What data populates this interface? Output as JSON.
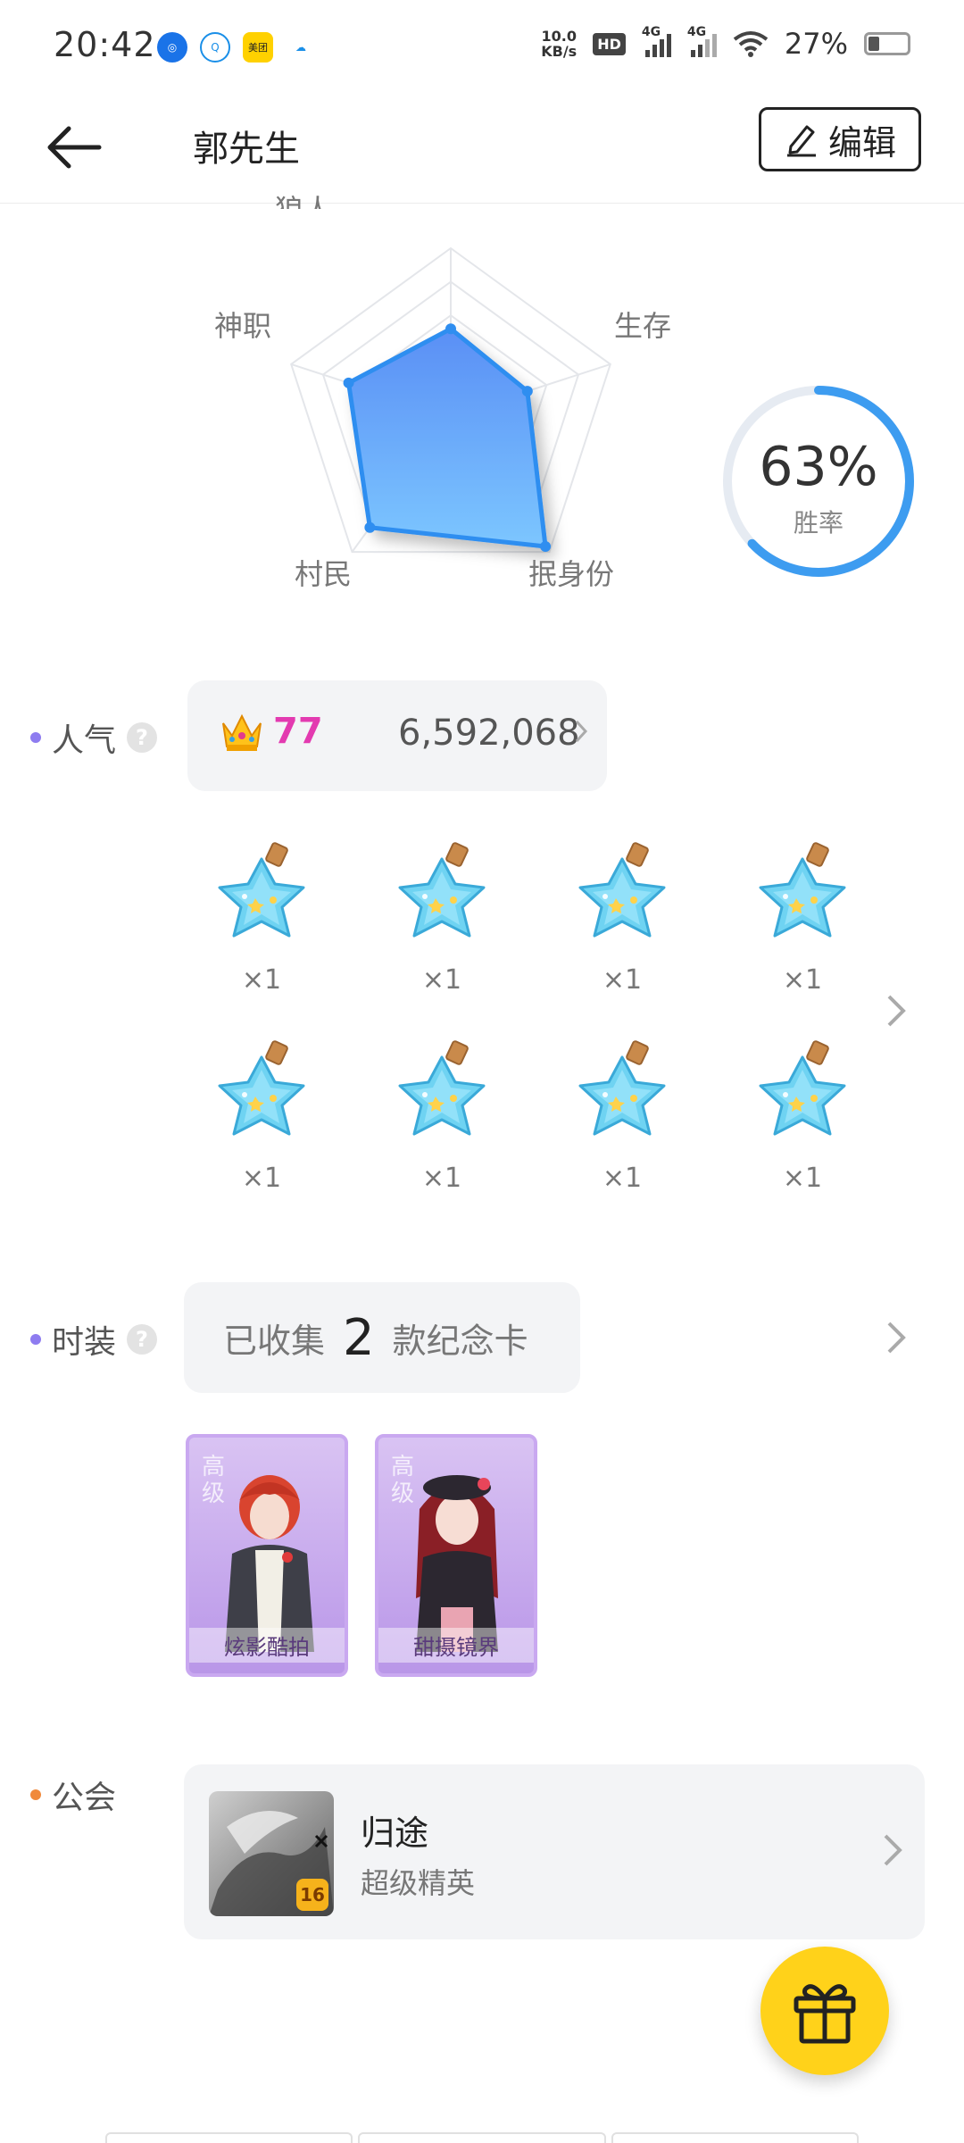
{
  "status_bar": {
    "time": "20:42",
    "net_speed_value": "10.0",
    "net_speed_unit": "KB/s",
    "hd_label": "HD",
    "signal_1": "4G",
    "signal_2": "4G",
    "battery": "27%",
    "app_icons": [
      "bank-app-icon",
      "q-app-icon",
      "meituan-app-icon",
      "cloud-app-icon"
    ],
    "meituan_label": "美团"
  },
  "header": {
    "title": "郭先生",
    "edit_label": "编辑"
  },
  "radar": {
    "axes": [
      "狼人",
      "生存",
      "抿身份",
      "村民",
      "神职"
    ],
    "top_label_visible": "狼人",
    "values": [
      0.52,
      0.48,
      0.96,
      0.82,
      0.64
    ],
    "fill_color": "#4a9bf5"
  },
  "winrate": {
    "value": "63%",
    "label": "胜率",
    "percent": 63,
    "ring_color": "#3d9cf0",
    "track_color": "#e6ebf2"
  },
  "popularity": {
    "label": "人气",
    "help": "?",
    "level": "77",
    "score": "6,592,068",
    "dot_color": "#8e7cf0",
    "level_color": "#e33ab0"
  },
  "gifts": {
    "items": [
      {
        "count": "×1"
      },
      {
        "count": "×1"
      },
      {
        "count": "×1"
      },
      {
        "count": "×1"
      },
      {
        "count": "×1"
      },
      {
        "count": "×1"
      },
      {
        "count": "×1"
      },
      {
        "count": "×1"
      }
    ]
  },
  "costume": {
    "label": "时装",
    "help": "?",
    "prefix": "已收集",
    "count": "2",
    "suffix": "款纪念卡",
    "dot_color": "#8e7cf0",
    "cards": [
      {
        "tier": "高级",
        "name": "炫影酷拍",
        "hair": "#d9442f"
      },
      {
        "tier": "高级",
        "name": "甜摄镜界",
        "hair": "#8a1f26"
      }
    ]
  },
  "guild": {
    "label": "公会",
    "name": "归途",
    "rank": "超级精英",
    "level": "16",
    "dot_color": "#f08a3c"
  }
}
